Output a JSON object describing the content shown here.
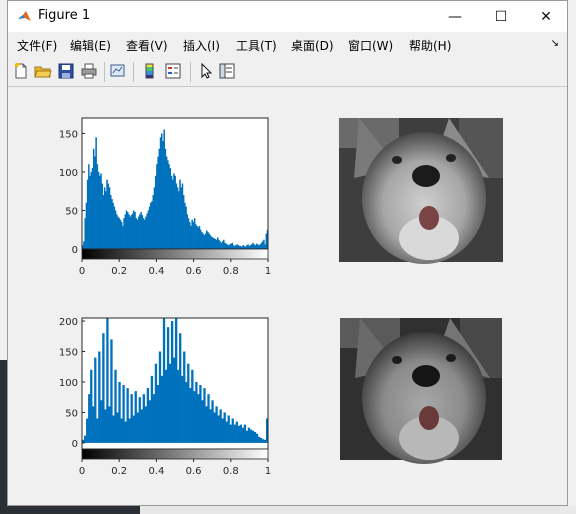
{
  "window": {
    "title": "Figure 1",
    "controls": {
      "minimize": "—",
      "maximize": "☐",
      "close": "✕"
    }
  },
  "menu": {
    "items": [
      "文件(F)",
      "编辑(E)",
      "查看(V)",
      "插入(I)",
      "工具(T)",
      "桌面(D)",
      "窗口(W)",
      "帮助(H)"
    ],
    "overflow_arrow": "↘"
  },
  "toolbar": {
    "icons": [
      "new-figure-icon",
      "open-file-icon",
      "save-icon",
      "print-icon",
      "link-plot-icon",
      "insert-colorbar-icon",
      "insert-legend-icon",
      "edit-plot-arrow-icon",
      "property-inspector-icon"
    ]
  },
  "colors": {
    "bar": "#0072bd",
    "axes_bg": "#ffffff",
    "figure_bg": "#f0f0f0"
  },
  "chart_data": [
    {
      "type": "bar",
      "description_key": "histogram-original",
      "xlim": [
        0,
        1
      ],
      "ylim": [
        0,
        170
      ],
      "xticks": [
        "0",
        "0.2",
        "0.4",
        "0.6",
        "0.8",
        "1"
      ],
      "yticks": [
        "0",
        "50",
        "100",
        "150"
      ],
      "ytick_values": [
        0,
        50,
        100,
        150
      ],
      "colorbar": "grayscale",
      "series": [
        {
          "values": [
            5,
            10,
            40,
            60,
            90,
            110,
            95,
            100,
            105,
            130,
            120,
            145,
            110,
            100,
            95,
            98,
            85,
            70,
            80,
            75,
            90,
            85,
            80,
            70,
            65,
            60,
            55,
            50,
            45,
            42,
            40,
            38,
            35,
            30,
            40,
            45,
            50,
            48,
            45,
            42,
            44,
            46,
            50,
            48,
            40,
            38,
            42,
            45,
            48,
            44,
            40,
            38,
            42,
            46,
            50,
            55,
            60,
            62,
            70,
            80,
            95,
            110,
            120,
            130,
            145,
            150,
            140,
            155,
            130,
            120,
            115,
            110,
            105,
            95,
            90,
            98,
            95,
            85,
            80,
            75,
            90,
            80,
            85,
            70,
            60,
            55,
            45,
            40,
            35,
            30,
            38,
            35,
            40,
            32,
            30,
            28,
            30,
            25,
            22,
            20,
            18,
            20,
            24,
            22,
            20,
            18,
            16,
            15,
            14,
            13,
            12,
            15,
            12,
            10,
            8,
            10,
            12,
            8,
            7,
            6,
            5,
            6,
            7,
            8,
            5,
            4,
            5,
            6,
            5,
            4,
            4,
            3,
            5,
            4,
            3,
            5,
            6,
            4,
            5,
            6,
            8,
            6,
            5,
            7,
            6,
            5,
            6,
            8,
            10,
            12,
            6,
            20,
            25
          ]
        }
      ]
    },
    {
      "type": "bar",
      "description_key": "histogram-adjusted",
      "xlim": [
        0,
        1
      ],
      "ylim": [
        -10,
        205
      ],
      "xticks": [
        "0",
        "0.2",
        "0.4",
        "0.6",
        "0.8",
        "1"
      ],
      "yticks": [
        "0",
        "50",
        "100",
        "150",
        "200"
      ],
      "ytick_values": [
        0,
        50,
        100,
        150,
        200
      ],
      "colorbar": "grayscale",
      "series": [
        {
          "values": [
            5,
            12,
            40,
            80,
            120,
            60,
            140,
            40,
            150,
            70,
            180,
            55,
            205,
            60,
            170,
            45,
            120,
            50,
            100,
            40,
            95,
            35,
            90,
            40,
            80,
            45,
            85,
            50,
            75,
            55,
            80,
            60,
            90,
            70,
            110,
            80,
            130,
            95,
            150,
            110,
            205,
            120,
            190,
            130,
            200,
            140,
            205,
            120,
            180,
            110,
            150,
            100,
            130,
            90,
            120,
            85,
            100,
            80,
            95,
            70,
            90,
            60,
            80,
            55,
            70,
            50,
            60,
            45,
            55,
            40,
            50,
            35,
            45,
            30,
            40,
            30,
            35,
            28,
            30,
            25,
            30,
            20,
            25,
            22,
            20,
            18,
            15,
            10,
            8,
            6,
            5,
            40
          ]
        }
      ]
    }
  ]
}
